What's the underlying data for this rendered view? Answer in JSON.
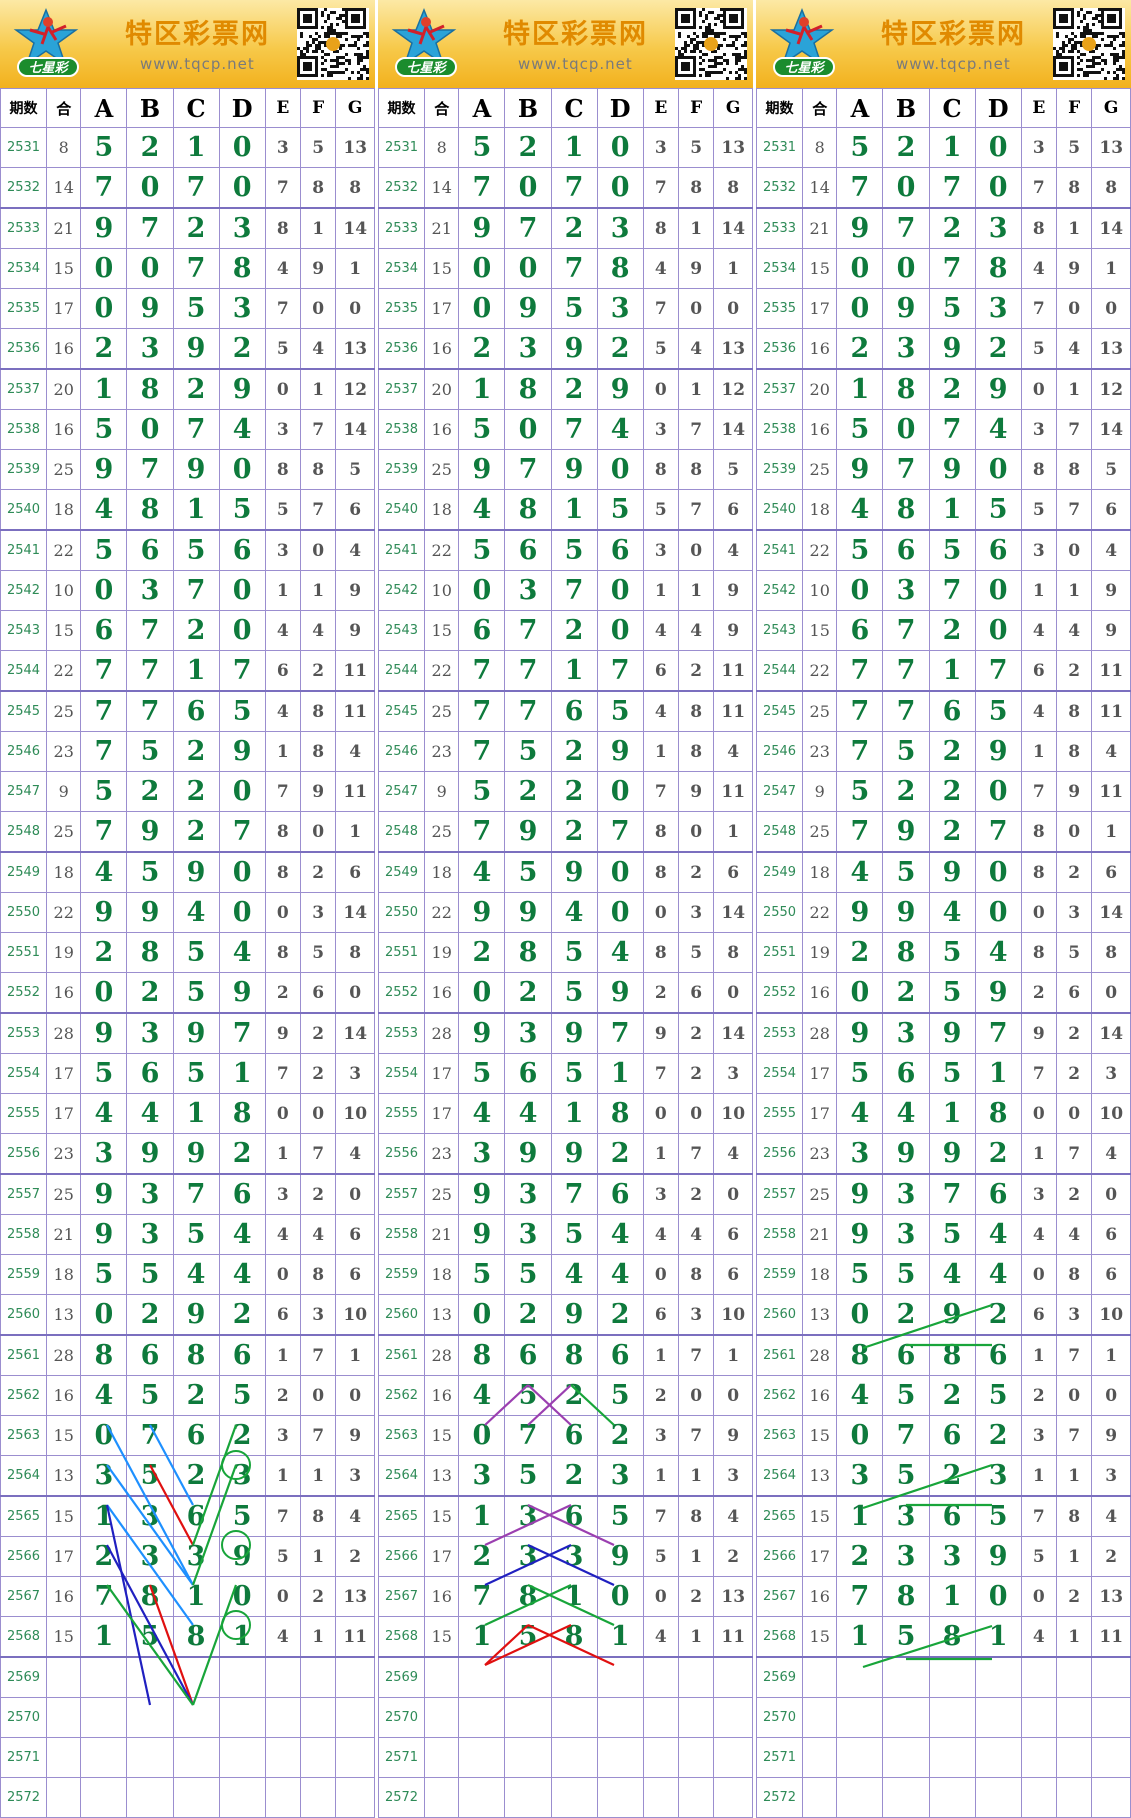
{
  "brand": {
    "site_name": "特区彩票网",
    "site_url": "www.tqcp.net",
    "logo_text": "七星彩"
  },
  "headers": [
    "期数",
    "合",
    "A",
    "B",
    "C",
    "D",
    "E",
    "F",
    "G"
  ],
  "rows": [
    {
      "p": "2531",
      "s": "8",
      "v": [
        "5",
        "2",
        "1",
        "0",
        "3",
        "5",
        "13"
      ]
    },
    {
      "p": "2532",
      "s": "14",
      "v": [
        "7",
        "0",
        "7",
        "0",
        "7",
        "8",
        "8"
      ]
    },
    {
      "p": "2533",
      "s": "21",
      "v": [
        "9",
        "7",
        "2",
        "3",
        "8",
        "1",
        "14"
      ]
    },
    {
      "p": "2534",
      "s": "15",
      "v": [
        "0",
        "0",
        "7",
        "8",
        "4",
        "9",
        "1"
      ]
    },
    {
      "p": "2535",
      "s": "17",
      "v": [
        "0",
        "9",
        "5",
        "3",
        "7",
        "0",
        "0"
      ]
    },
    {
      "p": "2536",
      "s": "16",
      "v": [
        "2",
        "3",
        "9",
        "2",
        "5",
        "4",
        "13"
      ]
    },
    {
      "p": "2537",
      "s": "20",
      "v": [
        "1",
        "8",
        "2",
        "9",
        "0",
        "1",
        "12"
      ]
    },
    {
      "p": "2538",
      "s": "16",
      "v": [
        "5",
        "0",
        "7",
        "4",
        "3",
        "7",
        "14"
      ]
    },
    {
      "p": "2539",
      "s": "25",
      "v": [
        "9",
        "7",
        "9",
        "0",
        "8",
        "8",
        "5"
      ]
    },
    {
      "p": "2540",
      "s": "18",
      "v": [
        "4",
        "8",
        "1",
        "5",
        "5",
        "7",
        "6"
      ]
    },
    {
      "p": "2541",
      "s": "22",
      "v": [
        "5",
        "6",
        "5",
        "6",
        "3",
        "0",
        "4"
      ]
    },
    {
      "p": "2542",
      "s": "10",
      "v": [
        "0",
        "3",
        "7",
        "0",
        "1",
        "1",
        "9"
      ]
    },
    {
      "p": "2543",
      "s": "15",
      "v": [
        "6",
        "7",
        "2",
        "0",
        "4",
        "4",
        "9"
      ]
    },
    {
      "p": "2544",
      "s": "22",
      "v": [
        "7",
        "7",
        "1",
        "7",
        "6",
        "2",
        "11"
      ]
    },
    {
      "p": "2545",
      "s": "25",
      "v": [
        "7",
        "7",
        "6",
        "5",
        "4",
        "8",
        "11"
      ]
    },
    {
      "p": "2546",
      "s": "23",
      "v": [
        "7",
        "5",
        "2",
        "9",
        "1",
        "8",
        "4"
      ]
    },
    {
      "p": "2547",
      "s": "9",
      "v": [
        "5",
        "2",
        "2",
        "0",
        "7",
        "9",
        "11"
      ]
    },
    {
      "p": "2548",
      "s": "25",
      "v": [
        "7",
        "9",
        "2",
        "7",
        "8",
        "0",
        "1"
      ]
    },
    {
      "p": "2549",
      "s": "18",
      "v": [
        "4",
        "5",
        "9",
        "0",
        "8",
        "2",
        "6"
      ]
    },
    {
      "p": "2550",
      "s": "22",
      "v": [
        "9",
        "9",
        "4",
        "0",
        "0",
        "3",
        "14"
      ]
    },
    {
      "p": "2551",
      "s": "19",
      "v": [
        "2",
        "8",
        "5",
        "4",
        "8",
        "5",
        "8"
      ]
    },
    {
      "p": "2552",
      "s": "16",
      "v": [
        "0",
        "2",
        "5",
        "9",
        "2",
        "6",
        "0"
      ]
    },
    {
      "p": "2553",
      "s": "28",
      "v": [
        "9",
        "3",
        "9",
        "7",
        "9",
        "2",
        "14"
      ]
    },
    {
      "p": "2554",
      "s": "17",
      "v": [
        "5",
        "6",
        "5",
        "1",
        "7",
        "2",
        "3"
      ]
    },
    {
      "p": "2555",
      "s": "17",
      "v": [
        "4",
        "4",
        "1",
        "8",
        "0",
        "0",
        "10"
      ]
    },
    {
      "p": "2556",
      "s": "23",
      "v": [
        "3",
        "9",
        "9",
        "2",
        "1",
        "7",
        "4"
      ]
    },
    {
      "p": "2557",
      "s": "25",
      "v": [
        "9",
        "3",
        "7",
        "6",
        "3",
        "2",
        "0"
      ]
    },
    {
      "p": "2558",
      "s": "21",
      "v": [
        "9",
        "3",
        "5",
        "4",
        "4",
        "4",
        "6"
      ]
    },
    {
      "p": "2559",
      "s": "18",
      "v": [
        "5",
        "5",
        "4",
        "4",
        "0",
        "8",
        "6"
      ]
    },
    {
      "p": "2560",
      "s": "13",
      "v": [
        "0",
        "2",
        "9",
        "2",
        "6",
        "3",
        "10"
      ]
    },
    {
      "p": "2561",
      "s": "28",
      "v": [
        "8",
        "6",
        "8",
        "6",
        "1",
        "7",
        "1"
      ]
    },
    {
      "p": "2562",
      "s": "16",
      "v": [
        "4",
        "5",
        "2",
        "5",
        "2",
        "0",
        "0"
      ]
    },
    {
      "p": "2563",
      "s": "15",
      "v": [
        "0",
        "7",
        "6",
        "2",
        "3",
        "7",
        "9"
      ]
    },
    {
      "p": "2564",
      "s": "13",
      "v": [
        "3",
        "5",
        "2",
        "3",
        "1",
        "1",
        "3"
      ]
    },
    {
      "p": "2565",
      "s": "15",
      "v": [
        "1",
        "3",
        "6",
        "5",
        "7",
        "8",
        "4"
      ]
    },
    {
      "p": "2566",
      "s": "17",
      "v": [
        "2",
        "3",
        "3",
        "9",
        "5",
        "1",
        "2"
      ]
    },
    {
      "p": "2567",
      "s": "16",
      "v": [
        "7",
        "8",
        "1",
        "0",
        "0",
        "2",
        "13"
      ]
    },
    {
      "p": "2568",
      "s": "15",
      "v": [
        "1",
        "5",
        "8",
        "1",
        "4",
        "1",
        "11"
      ]
    },
    {
      "p": "2569",
      "s": "",
      "v": [
        "",
        "",
        "",
        "",
        "",
        "",
        ""
      ]
    },
    {
      "p": "2570",
      "s": "",
      "v": [
        "",
        "",
        "",
        "",
        "",
        "",
        ""
      ]
    },
    {
      "p": "2571",
      "s": "",
      "v": [
        "",
        "",
        "",
        "",
        "",
        "",
        ""
      ]
    },
    {
      "p": "2572",
      "s": "",
      "v": [
        "",
        "",
        "",
        "",
        "",
        "",
        ""
      ]
    }
  ],
  "panel_overrides": [
    {},
    {},
    {
      "2558": {
        "4": "4"
      }
    }
  ],
  "colors": {
    "number_green": "#0e7a3c",
    "period_green": "#2e8b57",
    "grid_purple": "#9b8ecf",
    "banner_gold": "#f7c94a",
    "line_blue": "#1e90ff",
    "line_red": "#e01010",
    "line_green": "#18a53a",
    "line_purple": "#9b3fb0",
    "line_navy": "#2020c0"
  }
}
